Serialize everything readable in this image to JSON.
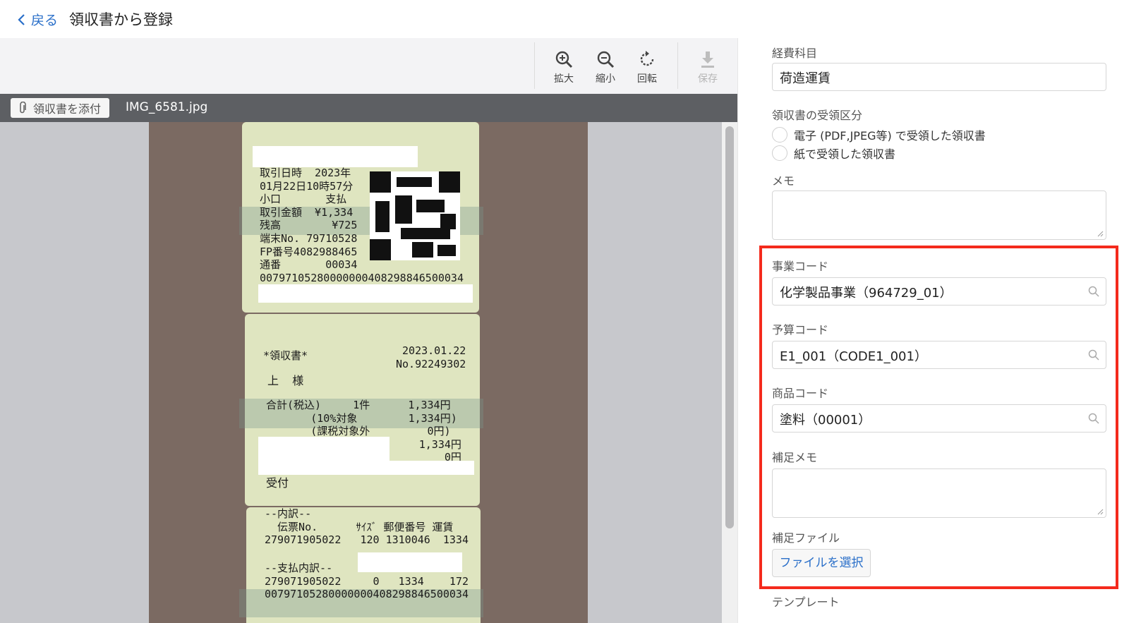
{
  "header": {
    "back_label": "戻る",
    "title": "領収書から登録"
  },
  "toolbar": {
    "zoom_in": "拡大",
    "zoom_out": "縮小",
    "rotate": "回転",
    "save": "保存"
  },
  "filebar": {
    "attach_label": "領収書を添付",
    "file_name": "IMG_6581.jpg"
  },
  "receipt": {
    "block1": "取引日時  2023年\n01月22日10時57分\n小口       支払\n取引金額  ¥1,334\n残高        ¥725\n端末No. 79710528\nFP番号4082988465\n通番       00034\n0079710528000000040829884650003​4",
    "title": "*領収書*",
    "date_no": "2023.01.22\nNo.92249302",
    "sama": "上  様",
    "totals": "合計(税込)     1件      1,334円\n       (10%対象        1,334円)\n       (課税対象外         0円)\n                        1,334円\n                            0円",
    "uketsuke": "受付",
    "uchiwake": "--内訳--\n  伝票No.      ｻｲｽﾞ 郵便番号 運賃\n279071905022   120 1310046  1334",
    "shiharai": "--支払内訳--\n279071905022     0   1334    172\n0079710528000000040829884650003​4"
  },
  "form": {
    "expense_category": {
      "label": "経費科目",
      "value": "荷造運賃"
    },
    "receipt_type": {
      "label": "領収書の受領区分",
      "options": [
        "電子 (PDF,JPEG等) で受領した領収書",
        "紙で受領した領収書"
      ]
    },
    "memo": {
      "label": "メモ",
      "value": ""
    },
    "business_code": {
      "label": "事業コード",
      "value": "化学製品事業（964729_01）"
    },
    "budget_code": {
      "label": "予算コード",
      "value": "E1_001（CODE1_001）"
    },
    "product_code": {
      "label": "商品コード",
      "value": "塗料（00001）"
    },
    "extra_memo": {
      "label": "補足メモ",
      "value": ""
    },
    "extra_file": {
      "label": "補足ファイル",
      "button": "ファイルを選択"
    },
    "template": {
      "label": "テンプレート"
    }
  },
  "colors": {
    "accent": "#2a6fc9",
    "highlight": "#f42a1c",
    "filebar": "#5d5f63"
  }
}
